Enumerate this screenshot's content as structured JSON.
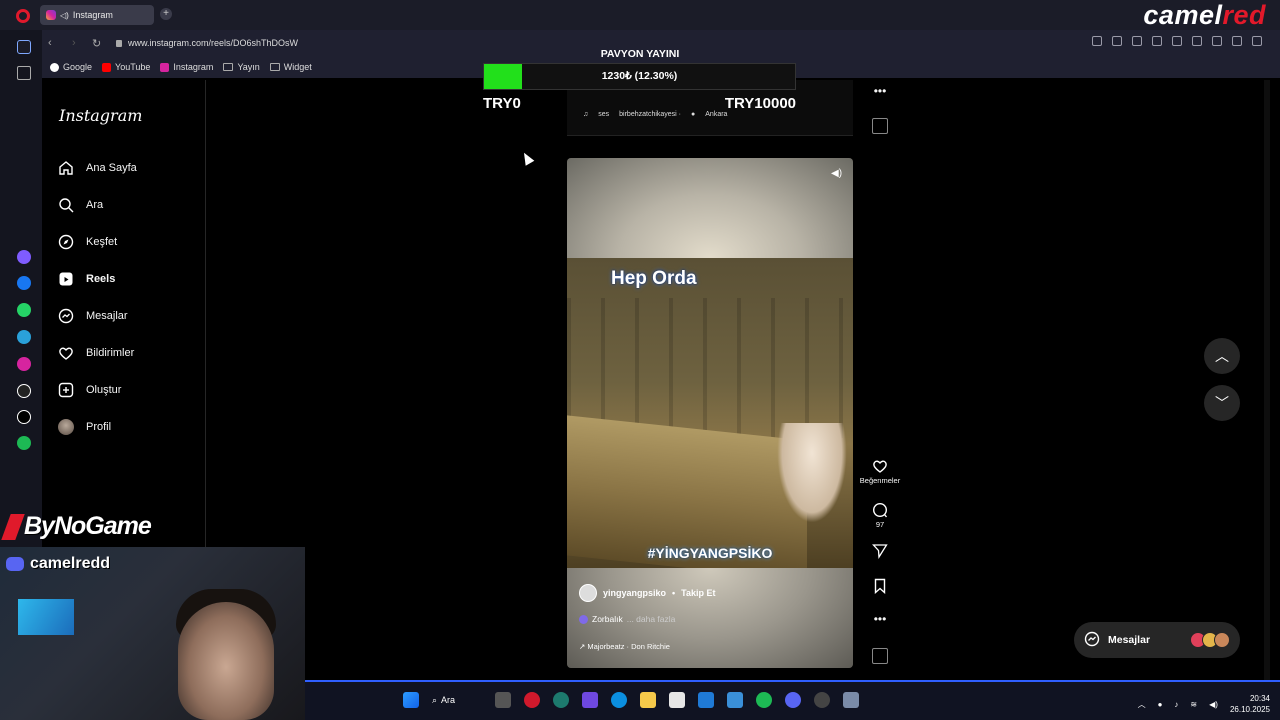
{
  "browser": {
    "tab_title": "Instagram",
    "url": "www.instagram.com/reels/DO6shThDOsW",
    "bookmarks": [
      {
        "label": "Google",
        "color": "#ffffff"
      },
      {
        "label": "YouTube",
        "color": "#ff0000"
      },
      {
        "label": "Instagram",
        "color": "#d6249f"
      },
      {
        "label": "Yayın",
        "color": ""
      },
      {
        "label": "Widget",
        "color": ""
      }
    ]
  },
  "brand": {
    "left": "camel",
    "right": "red"
  },
  "instagram": {
    "logo": "Instagram",
    "nav": [
      {
        "label": "Ana Sayfa",
        "icon": "home-icon"
      },
      {
        "label": "Ara",
        "icon": "search-icon"
      },
      {
        "label": "Keşfet",
        "icon": "compass-icon"
      },
      {
        "label": "Reels",
        "icon": "reels-icon"
      },
      {
        "label": "Mesajlar",
        "icon": "messenger-icon"
      },
      {
        "label": "Bildirimler",
        "icon": "heart-icon"
      },
      {
        "label": "Oluştur",
        "icon": "plus-icon"
      },
      {
        "label": "Profil",
        "icon": "avatar"
      }
    ],
    "prev_reel": {
      "audio": "ses",
      "audio_owner": "birbehzatchikayesi ·",
      "location": "Ankara"
    },
    "reel": {
      "title_text": "Hep Orda",
      "hashtag": "#YİNGYANGPSİKO",
      "username": "yingyangpsiko",
      "follow": "Takip Et",
      "caption": "Zorbalık",
      "more": "... daha fazla",
      "audio": "Majorbeatz · Don Ritchie"
    },
    "actions": {
      "likes_label": "Beğenmeler",
      "comments_count": "97"
    },
    "messages_pill": "Mesajlar"
  },
  "overlay": {
    "donation_title": "PAVYON YAYINI",
    "donation_progress_text": "1230₺ (12.30%)",
    "donation_progress": 0.123,
    "donation_min": "TRY0",
    "donation_max": "TRY10000",
    "sponsor": "ByNoGame",
    "discord": "camelredd"
  },
  "taskbar": {
    "search": "Ara",
    "time": "20:34",
    "date": "26.10.2025"
  }
}
